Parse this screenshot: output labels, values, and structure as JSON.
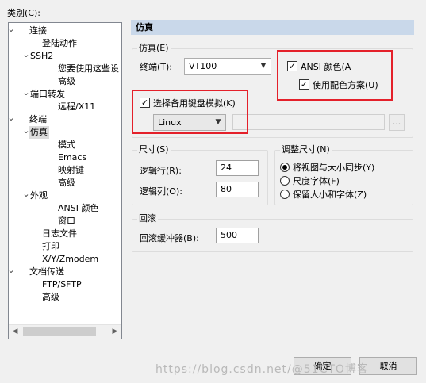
{
  "category_label": "类别(C):",
  "tree": [
    {
      "label": "连接",
      "twisty": "minus",
      "level": 0
    },
    {
      "label": "登陆动作",
      "twisty": "",
      "level": 2
    },
    {
      "label": "SSH2",
      "twisty": "minus",
      "level": 1
    },
    {
      "label": "您要使用这些设",
      "twisty": "",
      "level": 3
    },
    {
      "label": "高级",
      "twisty": "",
      "level": 3
    },
    {
      "label": "端口转发",
      "twisty": "minus",
      "level": 1
    },
    {
      "label": "远程/X11",
      "twisty": "",
      "level": 3
    },
    {
      "label": "终端",
      "twisty": "minus",
      "level": 0
    },
    {
      "label": "仿真",
      "twisty": "minus",
      "level": 1,
      "selected": true
    },
    {
      "label": "模式",
      "twisty": "",
      "level": 3
    },
    {
      "label": "Emacs",
      "twisty": "",
      "level": 3
    },
    {
      "label": "映射键",
      "twisty": "",
      "level": 3
    },
    {
      "label": "高级",
      "twisty": "",
      "level": 3
    },
    {
      "label": "外观",
      "twisty": "minus",
      "level": 1
    },
    {
      "label": "ANSI 颜色",
      "twisty": "",
      "level": 3
    },
    {
      "label": "窗口",
      "twisty": "",
      "level": 3
    },
    {
      "label": "日志文件",
      "twisty": "",
      "level": 2
    },
    {
      "label": "打印",
      "twisty": "",
      "level": 2
    },
    {
      "label": "X/Y/Zmodem",
      "twisty": "",
      "level": 2
    },
    {
      "label": "文档传送",
      "twisty": "minus",
      "level": 0
    },
    {
      "label": "FTP/SFTP",
      "twisty": "",
      "level": 2
    },
    {
      "label": "高级",
      "twisty": "",
      "level": 2
    }
  ],
  "header_title": "仿真",
  "emulation": {
    "group_title": "仿真(E)",
    "terminal_label": "终端(T):",
    "terminal_value": "VT100",
    "ansi_color_label": "ANSI 颜色(A",
    "ansi_color_checked": "✓",
    "use_color_scheme_label": "使用配色方案(U)",
    "use_color_scheme_checked": "✓",
    "alt_keyboard_label": "选择备用键盘模拟(K)",
    "alt_keyboard_checked": "✓",
    "keyboard_value": "Linux",
    "browse_label": "..."
  },
  "size": {
    "group_title": "尺寸(S)",
    "rows_label": "逻辑行(R):",
    "rows_value": "24",
    "cols_label": "逻辑列(O):",
    "cols_value": "80"
  },
  "resize": {
    "group_title": "调整尺寸(N)",
    "options": [
      "将视图与大小同步(Y)",
      "尺度字体(F)",
      "保留大小和字体(Z)"
    ],
    "selected_index": 0
  },
  "scrollback": {
    "group_title": "回滚",
    "buffer_label": "回滚缓冲器(B):",
    "buffer_value": "500"
  },
  "buttons": {
    "ok": "确定",
    "cancel": "取消"
  },
  "watermark": "https://blog.csdn.net/@51CTO博客",
  "colors": {
    "header_bg": "#c9d8ea",
    "highlight_red": "#e4202a"
  }
}
